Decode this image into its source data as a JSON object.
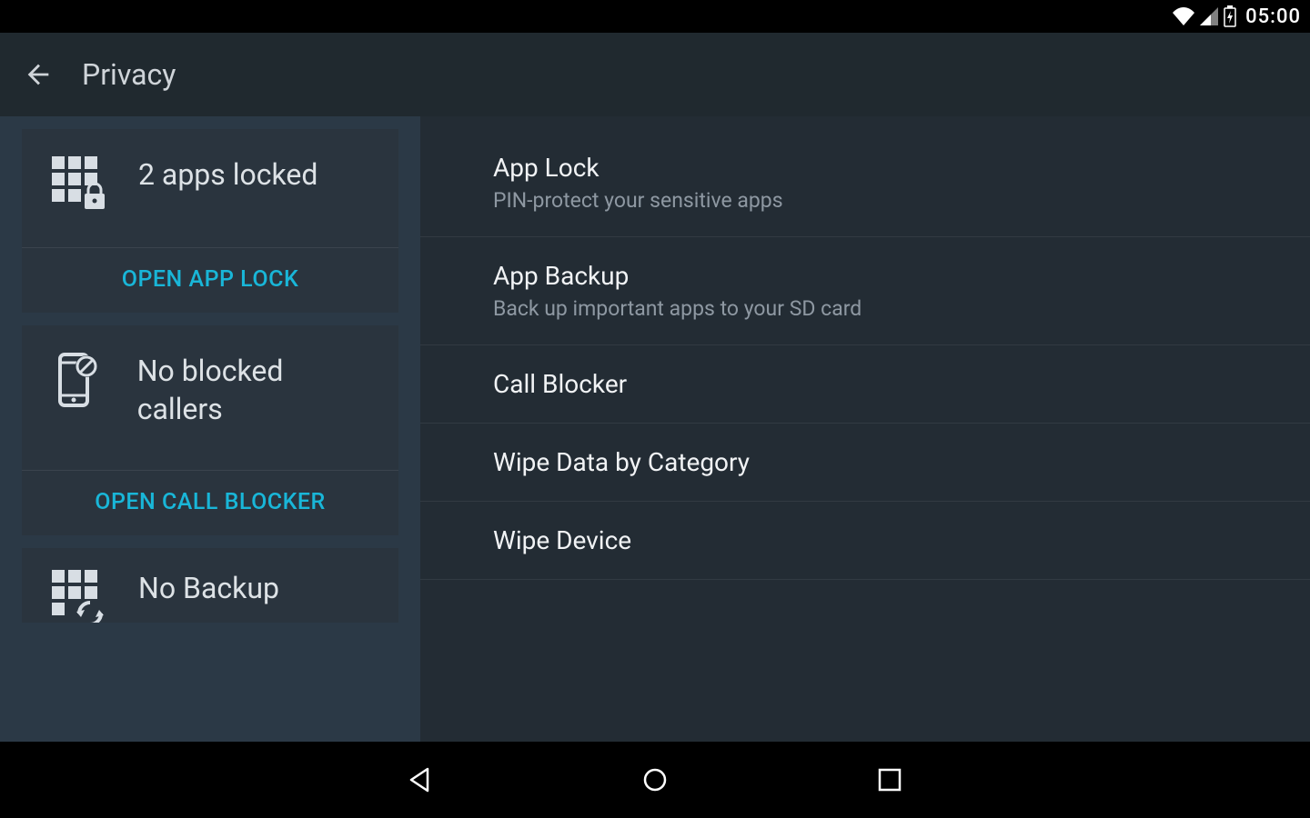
{
  "status": {
    "time": "05:00"
  },
  "appbar": {
    "title": "Privacy"
  },
  "cards": [
    {
      "title": "2 apps locked",
      "action": "OPEN APP LOCK"
    },
    {
      "title": "No blocked callers",
      "action": "OPEN CALL BLOCKER"
    },
    {
      "title": "No Backup"
    }
  ],
  "list": [
    {
      "title": "App Lock",
      "sub": "PIN-protect your sensitive apps"
    },
    {
      "title": "App Backup",
      "sub": "Back up important apps to your SD card"
    },
    {
      "title": "Call Blocker"
    },
    {
      "title": "Wipe Data by Category"
    },
    {
      "title": "Wipe Device"
    }
  ],
  "colors": {
    "accent": "#19B6D8"
  }
}
